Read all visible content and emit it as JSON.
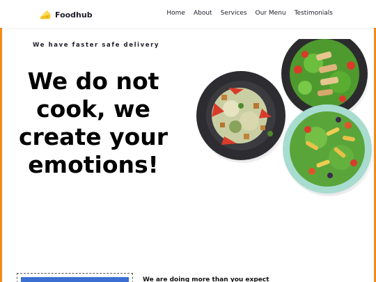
{
  "brand": {
    "name": "Foodhub",
    "logo_icon": "cheese-icon",
    "logo_color": "#f6c323"
  },
  "nav": {
    "items": [
      "Home",
      "About",
      "Services",
      "Our Menu",
      "Testimonials"
    ]
  },
  "hero": {
    "tagline": "We have faster safe delivery",
    "headline_lines": [
      "We do not",
      "cook, we",
      "create your",
      "emotions!"
    ]
  },
  "frame_color": "#f28a1a",
  "section": {
    "heading": "We are doing more than you expect"
  }
}
